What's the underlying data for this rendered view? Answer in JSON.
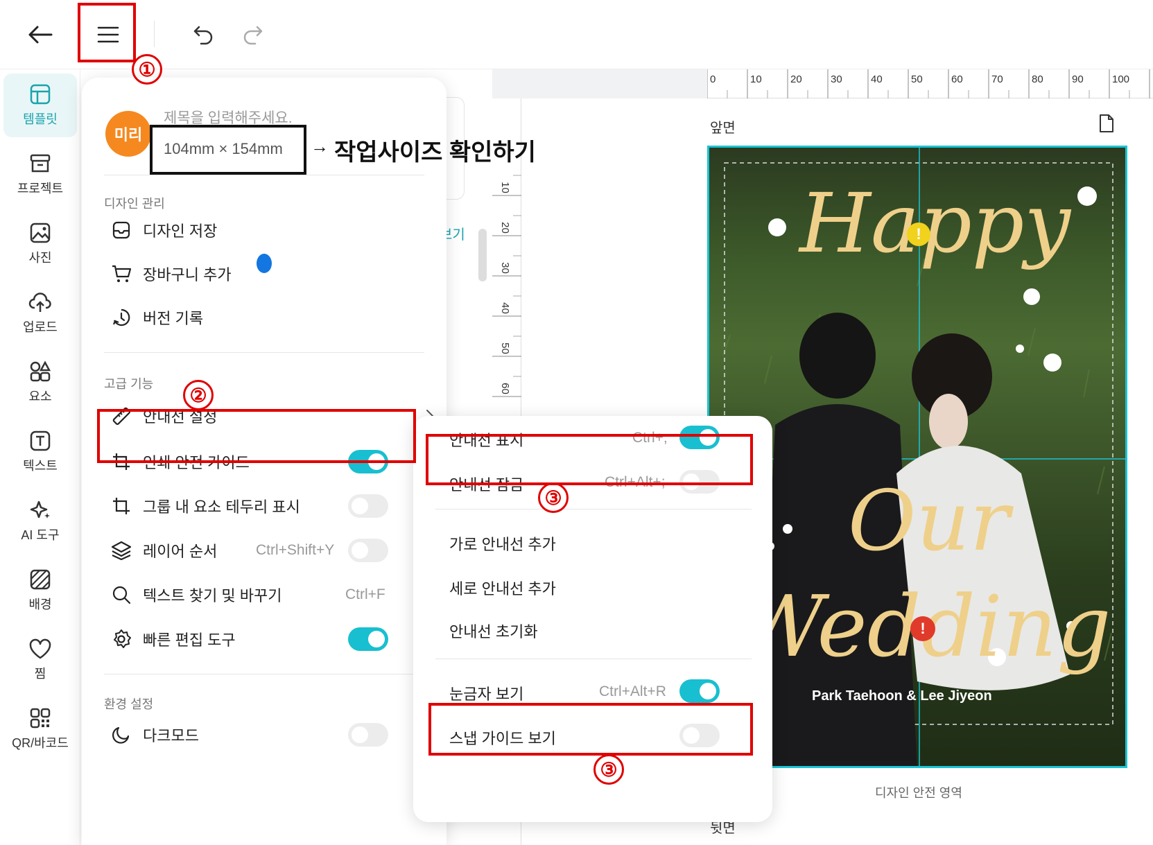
{
  "topbar": {
    "back_icon": "arrow-left-icon",
    "menu_icon": "hamburger-icon",
    "undo_icon": "undo-icon",
    "redo_icon": "redo-icon"
  },
  "sidebar": {
    "items": [
      {
        "label": "템플릿",
        "icon": "template-icon"
      },
      {
        "label": "프로젝트",
        "icon": "project-icon"
      },
      {
        "label": "사진",
        "icon": "photo-icon"
      },
      {
        "label": "업로드",
        "icon": "upload-icon"
      },
      {
        "label": "요소",
        "icon": "elements-icon"
      },
      {
        "label": "텍스트",
        "icon": "text-icon"
      },
      {
        "label": "AI 도구",
        "icon": "ai-tool-icon"
      },
      {
        "label": "배경",
        "icon": "background-icon"
      },
      {
        "label": "찜",
        "icon": "heart-icon"
      },
      {
        "label": "QR/바코드",
        "icon": "qr-icon"
      }
    ]
  },
  "menu": {
    "avatar_text": "미리",
    "title_placeholder": "제목을 입력해주세요.",
    "size": "104mm × 154mm",
    "section_design": "디자인 관리",
    "design_items": [
      {
        "label": "디자인 저장",
        "icon": "save-icon"
      },
      {
        "label": "장바구니 추가",
        "icon": "cart-icon"
      },
      {
        "label": "버전 기록",
        "icon": "history-icon"
      }
    ],
    "section_advanced": "고급 기능",
    "guide_settings": "안내선 설정",
    "advanced_items": [
      {
        "label": "인쇄 안전 가이드",
        "icon": "crop-icon",
        "shortcut": "",
        "toggle": true
      },
      {
        "label": "그룹 내 요소 테두리 표시",
        "icon": "crop-icon",
        "shortcut": "",
        "toggle": false
      },
      {
        "label": "레이어 순서",
        "icon": "layers-icon",
        "shortcut": "Ctrl+Shift+Y",
        "toggle": false
      },
      {
        "label": "텍스트 찾기 및 바꾸기",
        "icon": "search-icon",
        "shortcut": "Ctrl+F",
        "toggle": null
      },
      {
        "label": "빠른 편집 도구",
        "icon": "gear-icon",
        "shortcut": "",
        "toggle": true
      }
    ],
    "section_env": "환경 설정",
    "dark_mode": "다크모드",
    "dark_mode_on": false
  },
  "submenu": {
    "items": [
      {
        "label": "안내선 표시",
        "shortcut": "Ctrl+;",
        "toggle": true
      },
      {
        "label": "안내선 잠금",
        "shortcut": "Ctrl+Alt+;",
        "toggle": false
      }
    ],
    "actions": [
      "가로 안내선 추가",
      "세로 안내선 추가",
      "안내선 초기화"
    ],
    "view_items": [
      {
        "label": "눈금자 보기",
        "shortcut": "Ctrl+Alt+R",
        "toggle": true
      },
      {
        "label": "스냅 가이드 보기",
        "shortcut": "",
        "toggle": false
      }
    ]
  },
  "annotations": {
    "size_note": "작업사이즈 확인하기",
    "arrow": "→",
    "step1": "①",
    "step2": "②",
    "step3a": "③",
    "step3b": "③"
  },
  "canvas": {
    "page_front": "앞면",
    "page_back": "뒷면",
    "safe_area": "디자인 안전 영역",
    "hidden_partial": "보기",
    "ruler_h": [
      "0",
      "10",
      "20",
      "30",
      "40",
      "50",
      "60",
      "70",
      "80",
      "90",
      "100"
    ],
    "ruler_v": [
      "10",
      "20",
      "30",
      "40",
      "50",
      "60"
    ],
    "design_script_1": "Happy",
    "design_script_2": "Our",
    "design_script_3": "Wedding",
    "design_names": "Park Taehoon & Lee Jiyeon"
  },
  "colors": {
    "accent": "#18bfd0",
    "annotation_red": "#e00000",
    "avatar": "#f5891f"
  }
}
